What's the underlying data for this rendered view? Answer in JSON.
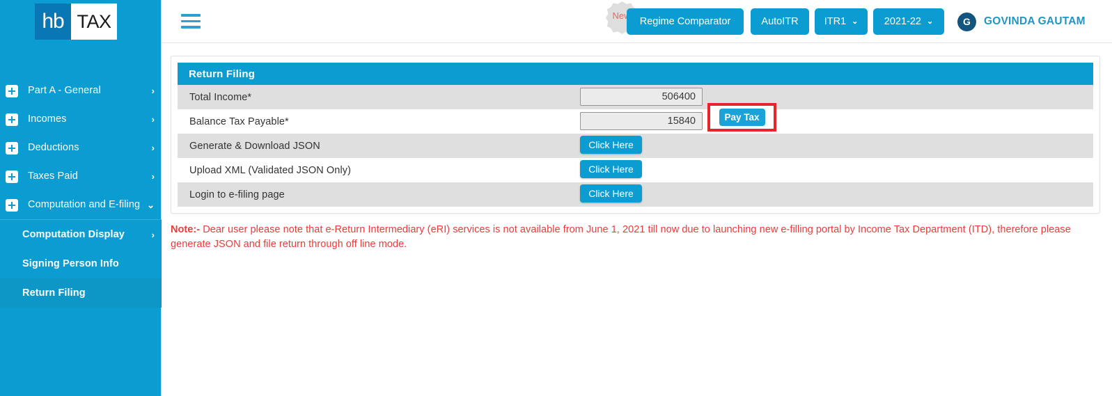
{
  "brand": {
    "logo_left": "hb",
    "logo_right": "TAX"
  },
  "colors": {
    "primary": "#0b9dd1",
    "logo_dark": "#0a77b5",
    "avatar": "#13557e",
    "username": "#2196c4",
    "note_red": "#ec3b3b",
    "highlight_red": "#e8252a",
    "row_stripe": "#dfdfdf",
    "badge_gray": "#dedede",
    "badge_text": "#ec6464"
  },
  "sidebar": {
    "items": [
      {
        "label": "Part A - General",
        "icon": "plus-box-icon",
        "chevron": "›"
      },
      {
        "label": "Incomes",
        "icon": "plus-box-icon",
        "chevron": "›"
      },
      {
        "label": "Deductions",
        "icon": "plus-box-icon",
        "chevron": "›"
      },
      {
        "label": "Taxes Paid",
        "icon": "plus-box-icon",
        "chevron": "›"
      },
      {
        "label": "Computation and E-filing",
        "icon": "plus-box-icon",
        "chevron": "⌄"
      }
    ],
    "subitems": [
      {
        "label": "Computation Display",
        "chevron": "›",
        "active": false
      },
      {
        "label": "Signing Person Info",
        "chevron": "",
        "active": false
      },
      {
        "label": "Return Filing",
        "chevron": "",
        "active": true
      }
    ]
  },
  "topbar": {
    "menu_icon": "hamburger-icon",
    "new_badge": "New",
    "regime_comparator": "Regime Comparator",
    "autoitr": "AutoITR",
    "itr_value": "ITR1",
    "itr_caret": "⌄",
    "year_value": "2021-22",
    "year_caret": "⌄",
    "avatar_initial": "G",
    "username": "GOVINDA GAUTAM"
  },
  "card": {
    "title": "Return Filing",
    "rows": [
      {
        "label": "Total Income*",
        "kind": "input",
        "value": "506400",
        "placeholder": ""
      },
      {
        "label": "Balance Tax Payable*",
        "kind": "input",
        "value": "15840",
        "placeholder": "",
        "action": "Pay Tax",
        "highlighted": true
      },
      {
        "label": "Generate & Download JSON",
        "kind": "button",
        "value": "Click Here"
      },
      {
        "label": "Upload XML (Validated JSON Only)",
        "kind": "button",
        "value": "Click Here"
      },
      {
        "label": "Login to e-filing page",
        "kind": "button",
        "value": "Click Here"
      }
    ]
  },
  "note": {
    "prefix": "Note:-",
    "text": " Dear user please note that e-Return Intermediary (eRI) services is not available from June 1, 2021 till now due to launching new e-filling portal by Income Tax Department (ITD), therefore please generate JSON and file return through off line mode."
  }
}
